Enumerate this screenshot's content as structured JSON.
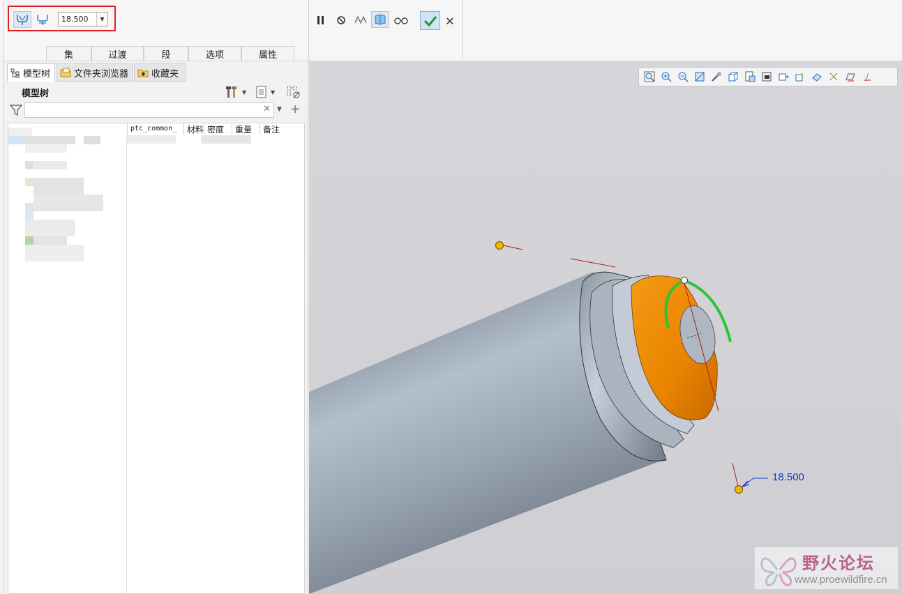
{
  "dashboard": {
    "value": "18.500",
    "tabs": [
      "集",
      "过渡",
      "段",
      "选项",
      "属性"
    ],
    "colors": {
      "highlight_box": "#e02020",
      "ok_button": "#cfe4f4"
    },
    "icons": [
      "round-set-icon",
      "round-transition-icon",
      "pause-icon",
      "no-preview-icon",
      "preview-icon",
      "verify-icon",
      "glasses-icon",
      "ok-check-icon",
      "cancel-x-icon"
    ]
  },
  "left_panel": {
    "tabs": [
      {
        "label": "模型树",
        "icon": "model-tree-icon"
      },
      {
        "label": "文件夹浏览器",
        "icon": "folder-browser-icon"
      },
      {
        "label": "收藏夹",
        "icon": "favorites-icon"
      }
    ],
    "tree_title": "模型树",
    "filter_value": "",
    "columns": [
      "ptc_common_",
      "材料",
      "密度",
      "重量",
      "备注"
    ]
  },
  "viewport": {
    "dimension_label": "18.500",
    "colors": {
      "selected_surface": "#ef8a00",
      "drag_arc": "#2ec236",
      "handle": "#f1b800",
      "dim_text": "#1d35c9"
    }
  },
  "watermark": {
    "text": "野火论坛",
    "url": "www.proewildfire.cn"
  }
}
